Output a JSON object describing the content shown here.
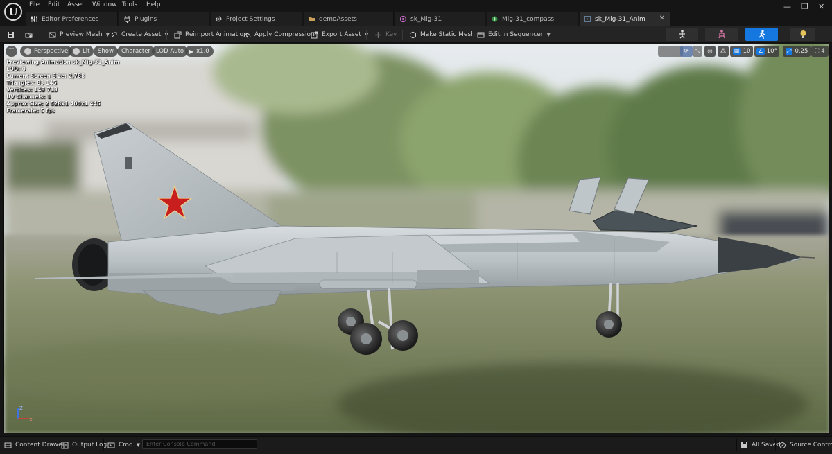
{
  "menu": [
    "File",
    "Edit",
    "Asset",
    "Window",
    "Tools",
    "Help"
  ],
  "tabs": [
    {
      "label": "Editor Preferences",
      "icon": "sliders-icon",
      "active": false
    },
    {
      "label": "Plugins",
      "icon": "plug-icon",
      "active": false
    },
    {
      "label": "Project Settings",
      "icon": "gear-icon",
      "active": false
    },
    {
      "label": "demoAssets",
      "icon": "folder-icon",
      "active": false
    },
    {
      "label": "sk_Mig-31",
      "icon": "skeleton-icon",
      "active": false
    },
    {
      "label": "Mig-31_compass",
      "icon": "compass-icon",
      "active": false
    },
    {
      "label": "sk_Mig-31_Anim",
      "icon": "animation-icon",
      "active": true
    }
  ],
  "toolbar": {
    "preview_mesh": "Preview Mesh",
    "create_asset": "Create Asset",
    "reimport": "Reimport Animation",
    "apply_compression": "Apply Compression",
    "export_asset": "Export Asset",
    "key": "Key",
    "make_static_mesh": "Make Static Mesh",
    "edit_in_sequencer": "Edit in Sequencer"
  },
  "viewport": {
    "perspective": "Perspective",
    "lit": "Lit",
    "show": "Show",
    "character": "Character",
    "lod": "LOD Auto",
    "play_rate": "x1.0",
    "grid_snap": "10",
    "rot_snap": "10°",
    "scale_snap": "0.25",
    "camera_speed": "4",
    "stats": [
      "Previewing Animation sk_Mig-31_Anim",
      "LOD: 0",
      "Current Screen Size: 2,788",
      "Triangles: 83 145",
      "Vertices: 148 713",
      "UV Channels: 1",
      "Approx Size: 2 528x1 400x1 445",
      "Framerate: 5 fps"
    ]
  },
  "statusbar": {
    "content_drawer": "Content Drawer",
    "output_log": "Output Log",
    "cmd": "Cmd",
    "console_placeholder": "Enter Console Command",
    "all_saved": "All Saved",
    "source_control": "Source Control"
  },
  "colors": {
    "accent": "#1478e0",
    "star": "#c81e1e",
    "sky": "#dfe6e8",
    "grass": "#7d8a5a"
  }
}
